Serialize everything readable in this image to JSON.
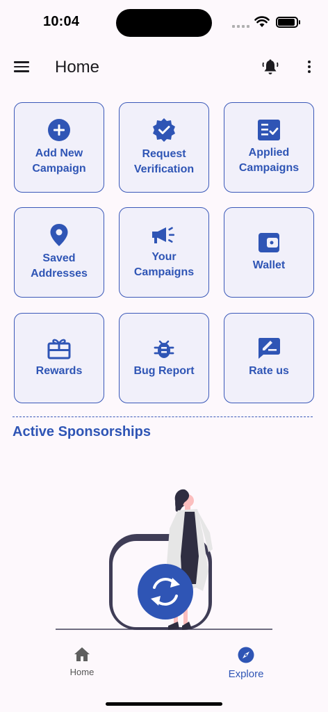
{
  "status_bar": {
    "time": "10:04"
  },
  "app_bar": {
    "title": "Home"
  },
  "tiles": [
    {
      "label": "Add New\nCampaign",
      "icon": "add-circle-icon"
    },
    {
      "label": "Request\nVerification",
      "icon": "verified-badge-icon"
    },
    {
      "label": "Applied\nCampaigns",
      "icon": "checklist-icon"
    },
    {
      "label": "Saved\nAddresses",
      "icon": "location-pin-icon"
    },
    {
      "label": "Your\nCampaigns",
      "icon": "megaphone-icon"
    },
    {
      "label": "Wallet",
      "icon": "wallet-icon"
    },
    {
      "label": "Rewards",
      "icon": "gift-card-icon"
    },
    {
      "label": "Bug Report",
      "icon": "bug-icon"
    },
    {
      "label": "Rate us",
      "icon": "rate-edit-icon"
    }
  ],
  "section": {
    "title": "Active Sponsorships"
  },
  "bottom_nav": {
    "home_label": "Home",
    "explore_label": "Explore"
  },
  "colors": {
    "accent": "#2f55b5",
    "tile_bg": "#f1f0fa",
    "tile_border": "#3a58b8",
    "background": "#fdf8fc"
  }
}
